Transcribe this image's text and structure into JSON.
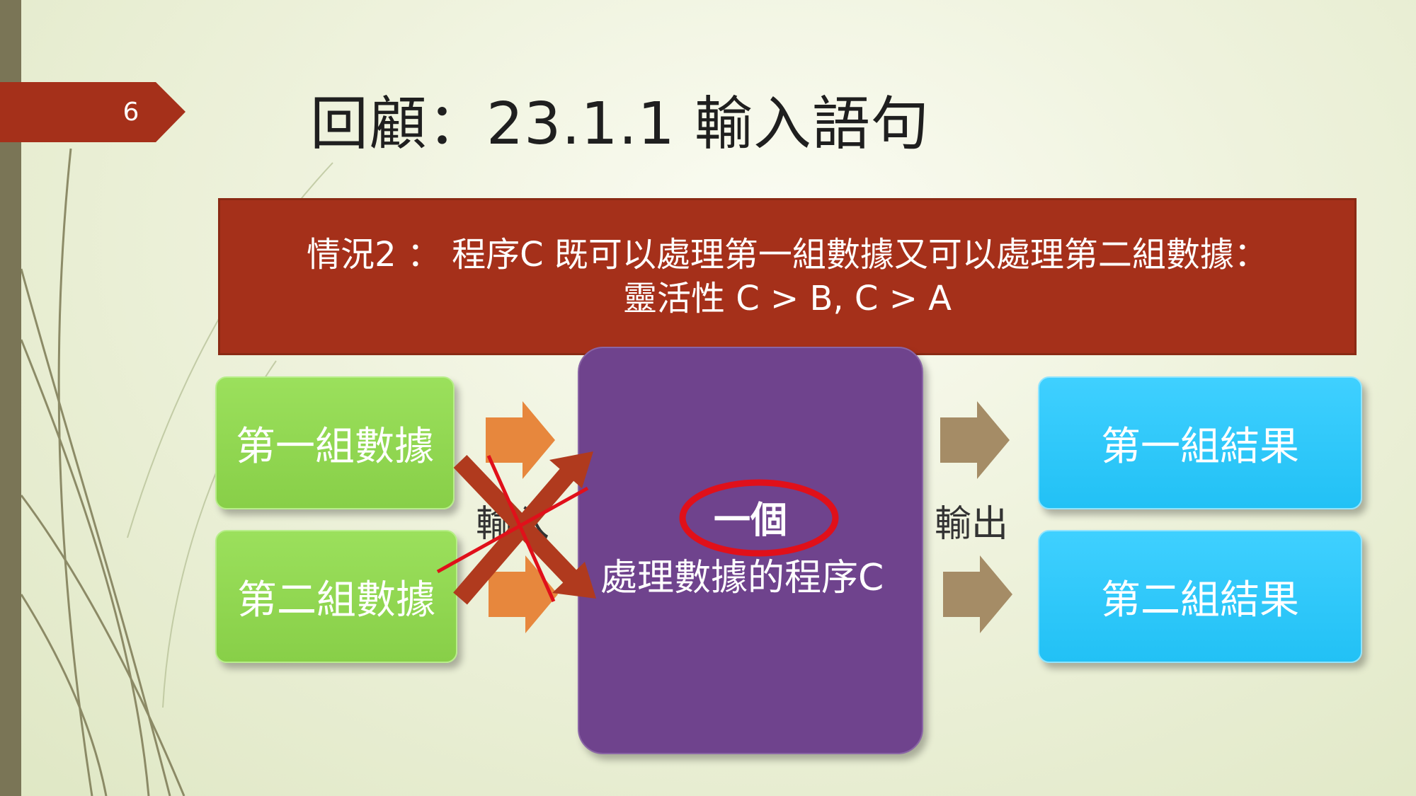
{
  "slide": {
    "page_number": "6",
    "title": "回顧：23.1.1 輸入語句"
  },
  "banner": {
    "line1": "情況2 ： 程序C 既可以處理第一組數據又可以處理第二組數據：",
    "line2": "靈活性 C > B, C > A"
  },
  "inputs": {
    "first": "第一組數據",
    "second": "第二組數據",
    "label": "輸入"
  },
  "process": {
    "highlight": "一個",
    "label": "處理數據的程序C"
  },
  "outputs": {
    "label": "輸出",
    "first": "第一組結果",
    "second": "第二組結果"
  },
  "colors": {
    "banner": "#a5301a",
    "input_box": "#92d050",
    "process_box": "#6f438d",
    "output_box": "#33ccff",
    "input_arrow": "#e7873d",
    "output_arrow": "#a58c66",
    "cross": "#b03a1e",
    "annotation_red": "#e0101a"
  }
}
